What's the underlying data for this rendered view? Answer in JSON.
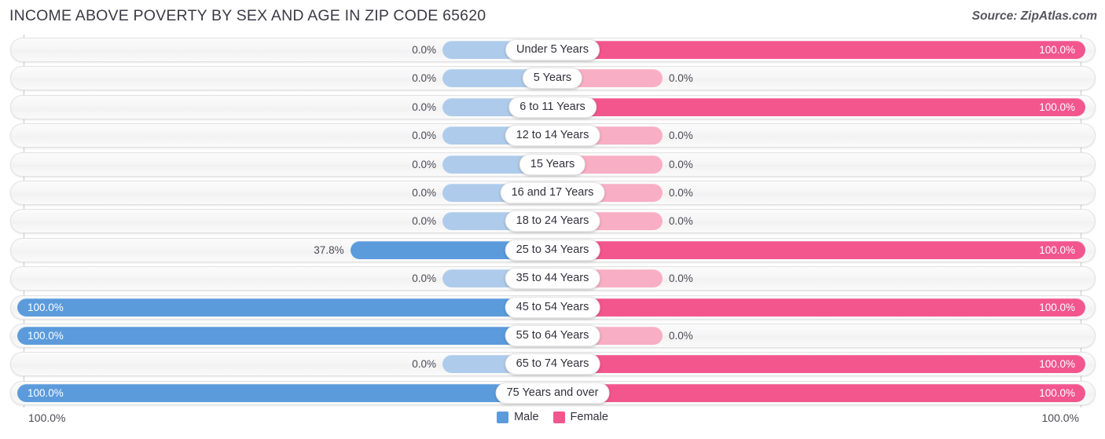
{
  "header": {
    "title": "INCOME ABOVE POVERTY BY SEX AND AGE IN ZIP CODE 65620",
    "source": "Source: ZipAtlas.com"
  },
  "legend": {
    "male_label": "Male",
    "female_label": "Female",
    "male_color": "#5b9bdc",
    "female_color": "#f2568c"
  },
  "axis": {
    "left_tick": "100.0%",
    "right_tick": "100.0%"
  },
  "chart_data": {
    "type": "bar",
    "title": "INCOME ABOVE POVERTY BY SEX AND AGE IN ZIP CODE 65620",
    "subtitle": "",
    "orientation": "horizontal-diverging",
    "xlabel": "",
    "ylabel": "",
    "xlim": [
      0,
      100
    ],
    "grid": false,
    "legend_position": "bottom-center",
    "categories": [
      "Under 5 Years",
      "5 Years",
      "6 to 11 Years",
      "12 to 14 Years",
      "15 Years",
      "16 and 17 Years",
      "18 to 24 Years",
      "25 to 34 Years",
      "35 to 44 Years",
      "45 to 54 Years",
      "55 to 64 Years",
      "65 to 74 Years",
      "75 Years and over"
    ],
    "series": [
      {
        "name": "Male",
        "color": "#5b9bdc",
        "values": [
          0.0,
          0.0,
          0.0,
          0.0,
          0.0,
          0.0,
          0.0,
          37.8,
          0.0,
          100.0,
          100.0,
          0.0,
          100.0
        ],
        "labels": [
          "0.0%",
          "0.0%",
          "0.0%",
          "0.0%",
          "0.0%",
          "0.0%",
          "0.0%",
          "37.8%",
          "0.0%",
          "100.0%",
          "100.0%",
          "0.0%",
          "100.0%"
        ]
      },
      {
        "name": "Female",
        "color": "#f2568c",
        "values": [
          100.0,
          0.0,
          100.0,
          0.0,
          0.0,
          0.0,
          0.0,
          100.0,
          0.0,
          100.0,
          0.0,
          100.0,
          100.0
        ],
        "labels": [
          "100.0%",
          "0.0%",
          "100.0%",
          "0.0%",
          "0.0%",
          "0.0%",
          "0.0%",
          "100.0%",
          "0.0%",
          "100.0%",
          "0.0%",
          "100.0%",
          "100.0%"
        ]
      }
    ]
  }
}
